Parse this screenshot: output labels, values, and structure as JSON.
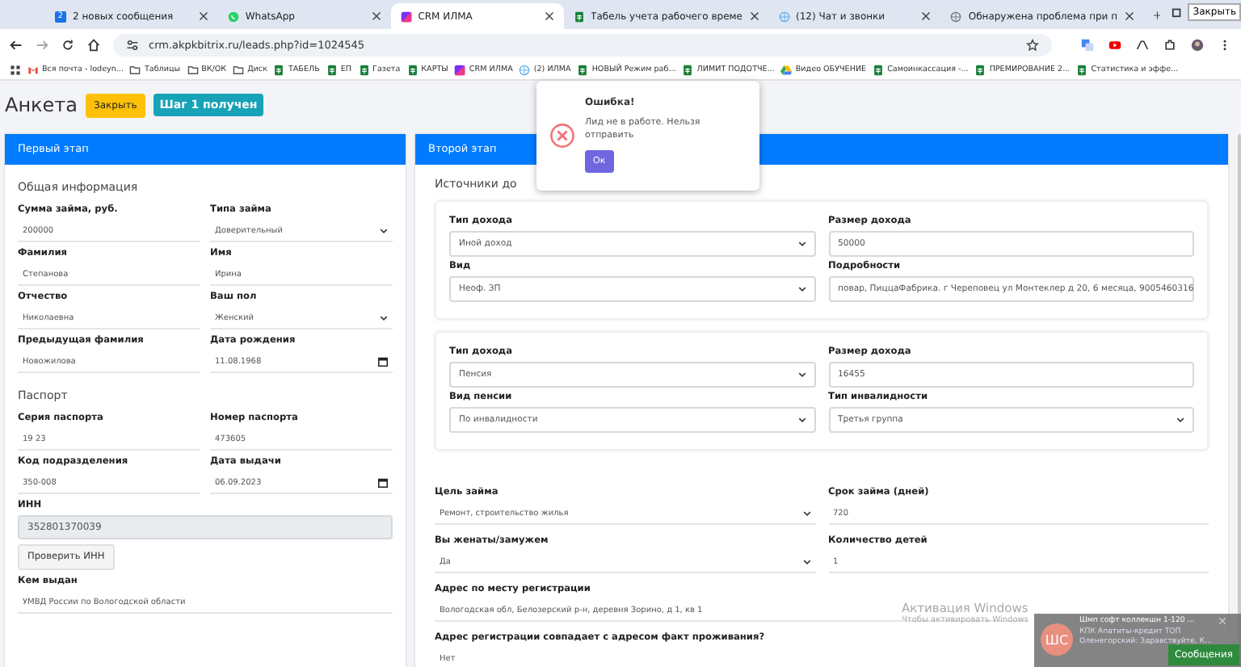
{
  "browser": {
    "tabs": [
      {
        "kind": "badge",
        "icon_text": "2",
        "title": "2 новых сообщения",
        "selected": false
      },
      {
        "kind": "whatsapp",
        "title": "WhatsApp",
        "selected": false
      },
      {
        "kind": "crm",
        "title": "CRM ИЛМА",
        "selected": true
      },
      {
        "kind": "sheet",
        "title": "Табель учета рабочего време",
        "selected": false
      },
      {
        "kind": "chat",
        "title": "(12) Чат и звонки",
        "selected": false
      },
      {
        "kind": "globe",
        "title": "Обнаружена проблема при п",
        "selected": false
      }
    ],
    "tooltip": "Закрыть",
    "address": "crm.akpkbitrix.ru/leads.php?id=1024545",
    "bookmarks": [
      {
        "kind": "mail",
        "label": "Вся почта - lodeyn..."
      },
      {
        "kind": "folder",
        "label": "Таблицы"
      },
      {
        "kind": "folder",
        "label": "ВК/ОК"
      },
      {
        "kind": "folder",
        "label": "Диск"
      },
      {
        "kind": "sheet",
        "label": "ТАБЕЛЬ"
      },
      {
        "kind": "sheet",
        "label": "ЕП"
      },
      {
        "kind": "sheet",
        "label": "Газета"
      },
      {
        "kind": "sheet",
        "label": "КАРТЫ"
      },
      {
        "kind": "crm",
        "label": "CRM ИЛМА"
      },
      {
        "kind": "chat",
        "label": "(2) ИЛМА"
      },
      {
        "kind": "sheet",
        "label": "НОВЫЙ Режим раб..."
      },
      {
        "kind": "sheet",
        "label": "ЛИМИТ ПОДОТЧЕ..."
      },
      {
        "kind": "drive",
        "label": "Видео ОБУЧЕНИЕ"
      },
      {
        "kind": "sheet",
        "label": "Самоинкассация -..."
      },
      {
        "kind": "sheet",
        "label": "ПРЕМИРОВАНИЕ 2..."
      },
      {
        "kind": "sheet",
        "label": "Статистика и эффе..."
      }
    ]
  },
  "page": {
    "title": "Анкета",
    "close_button": "Закрыть",
    "badge": "Шаг 1 получен"
  },
  "first_stage": {
    "header": "Первый этап",
    "sections": [
      {
        "title": "Общая информация",
        "fields": [
          {
            "kind": "text",
            "label": "Сумма займа, руб.",
            "value": "200000"
          },
          {
            "kind": "select",
            "label": "Типа займа",
            "value": "Доверительный"
          },
          {
            "kind": "text",
            "label": "Фамилия",
            "value": "Степанова"
          },
          {
            "kind": "text",
            "label": "Имя",
            "value": "Ирина"
          },
          {
            "kind": "text",
            "label": "Отчество",
            "value": "Николаевна"
          },
          {
            "kind": "select",
            "label": "Ваш пол",
            "value": "Женский"
          },
          {
            "kind": "text",
            "label": "Предыдущая фамилия",
            "value": "Новожилова"
          },
          {
            "kind": "date",
            "label": "Дата рождения",
            "value": "11.08.1968"
          }
        ]
      },
      {
        "title": "Паспорт",
        "fields": [
          {
            "kind": "text",
            "label": "Серия паспорта",
            "value": "19 23"
          },
          {
            "kind": "text",
            "label": "Номер паспорта",
            "value": "473605"
          },
          {
            "kind": "text",
            "label": "Код подразделения",
            "value": "350-008"
          },
          {
            "kind": "date",
            "label": "Дата выдачи",
            "value": "06.09.2023"
          },
          {
            "kind": "readonly",
            "label": "ИНН",
            "value": "352801370039"
          },
          {
            "kind": "button",
            "value": "Проверить ИНН"
          },
          {
            "kind": "wide",
            "label": "Кем выдан",
            "value": "УМВД России по Вологодской области"
          }
        ]
      }
    ]
  },
  "second_stage": {
    "header": "Второй этап",
    "section_title": "Источники до",
    "income_blocks": [
      {
        "fields": [
          {
            "kind": "select",
            "label": "Тип дохода",
            "value": "Иной доход"
          },
          {
            "kind": "text",
            "label": "Размер дохода",
            "value": "50000"
          },
          {
            "kind": "select",
            "label": "Вид",
            "value": "Неоф. ЗП"
          },
          {
            "kind": "text",
            "label": "Подробности",
            "value": "повар, ПиццаФабрика. г Череповец ул Монтеклер д 20, 6 месяца, 9005460316"
          }
        ]
      },
      {
        "fields": [
          {
            "kind": "select",
            "label": "Тип дохода",
            "value": "Пенсия"
          },
          {
            "kind": "text",
            "label": "Размер дохода",
            "value": "16455"
          },
          {
            "kind": "select",
            "label": "Вид пенсии",
            "value": "По инвалидности"
          },
          {
            "kind": "select",
            "label": "Тип инвалидности",
            "value": "Третья группа"
          }
        ]
      }
    ],
    "fields": [
      {
        "kind": "select",
        "label": "Цель займа",
        "value": "Ремонт, строительство жилья"
      },
      {
        "kind": "text",
        "label": "Срок займа (дней)",
        "value": "720"
      },
      {
        "kind": "select",
        "label": "Вы женаты/замужем",
        "value": "Да"
      },
      {
        "kind": "text",
        "label": "Количество детей",
        "value": "1"
      },
      {
        "kind": "wide",
        "label": "Адрес по месту регистрации",
        "value": "Вологодская обл, Белозерский р-н, деревня Зорино, д 1, кв 1"
      },
      {
        "kind": "wide",
        "label": "Адрес регистрации совпадает с адресом факт проживания?",
        "value": "Нет"
      }
    ]
  },
  "dialog": {
    "title": "Ошибка!",
    "message": "Лид не в работе. Нельзя отправить",
    "ok_button": "Ок"
  },
  "windows_activation": [
    "Активация Windows",
    "Чтобы активировать Windows"
  ],
  "notification": {
    "avatar": "ШС",
    "title": "Шмп софт коллекшн 1-120 ...",
    "lines": [
      "КПК Апатиты-кредит ТОП",
      "Оленегорский: Здравствуйте, К..."
    ],
    "button": "Сообщения"
  }
}
